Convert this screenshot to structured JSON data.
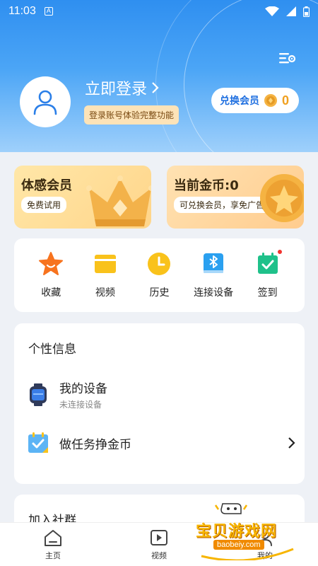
{
  "status_bar": {
    "time": "11:03",
    "notification_icon": "A"
  },
  "header": {
    "login_label": "立即登录",
    "login_tip": "登录账号体验完整功能",
    "exchange_label": "兑换会员",
    "coin_count": "0"
  },
  "cards": {
    "vip": {
      "title": "体感会员",
      "pill": "免费试用"
    },
    "coins": {
      "title": "当前金币:0",
      "pill": "可兑换会员，享免广告特权"
    }
  },
  "actions": [
    {
      "label": "收藏",
      "icon": "star-icon",
      "color": "#f7731e"
    },
    {
      "label": "视频",
      "icon": "video-folder-icon",
      "color": "#f9c21b"
    },
    {
      "label": "历史",
      "icon": "clock-icon",
      "color": "#f9c21b"
    },
    {
      "label": "连接设备",
      "icon": "bluetooth-icon",
      "color": "#2aa0f0"
    },
    {
      "label": "签到",
      "icon": "calendar-check-icon",
      "color": "#1fc18a"
    }
  ],
  "personal_info": {
    "heading": "个性信息",
    "rows": [
      {
        "title": "我的设备",
        "subtitle": "未连接设备",
        "icon": "watch-icon"
      },
      {
        "title": "做任务挣金币",
        "subtitle": "",
        "icon": "task-calendar-icon"
      }
    ]
  },
  "community": {
    "heading": "加入社群"
  },
  "bottom_nav": [
    {
      "label": "主页",
      "icon": "home-icon"
    },
    {
      "label": "视频",
      "icon": "play-icon"
    },
    {
      "label": "我的",
      "icon": "profile-icon"
    }
  ],
  "watermark": {
    "text": "宝贝游戏网",
    "url": "baobeiy.com"
  },
  "colors": {
    "primary_blue": "#2f8ff0",
    "coin_orange": "#f0a020",
    "link_blue": "#1f6fe0"
  }
}
